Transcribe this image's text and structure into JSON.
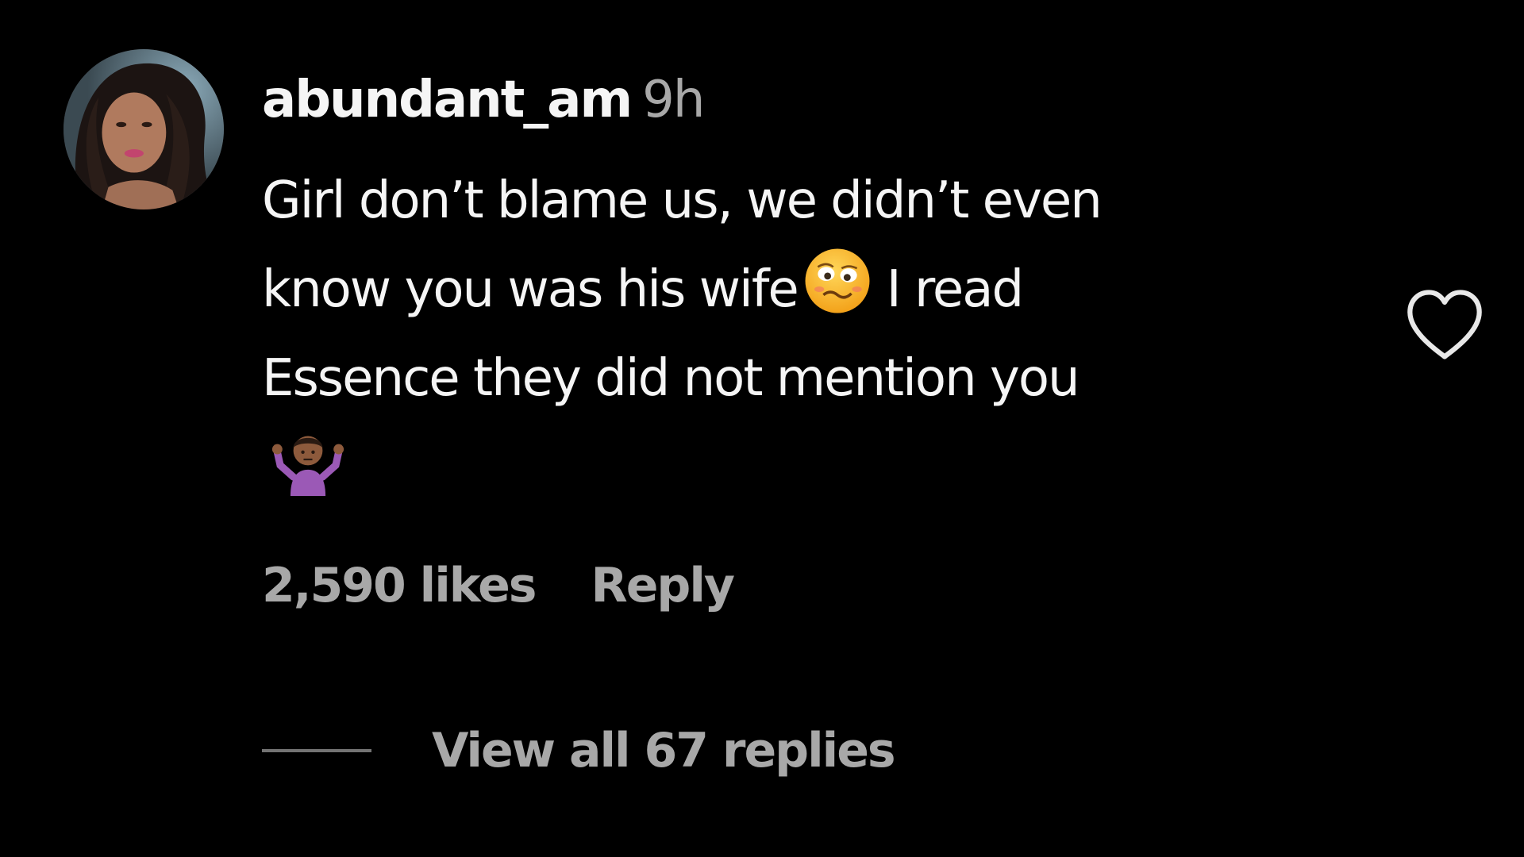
{
  "comment": {
    "username": "abundant_am",
    "timestamp": "9h",
    "text_lines": [
      "Girl don’t blame us, we didn’t even",
      "know you was his wife",
      "I read",
      "Essence they did not mention you"
    ],
    "emojis": [
      "woozy-face-emoji",
      "person-shrugging-emoji"
    ],
    "likes": "2,590 likes",
    "reply_label": "Reply",
    "view_replies_label": "View all 67 replies",
    "like_icon": "heart-outline-icon"
  },
  "colors": {
    "background": "#000000",
    "primary_text": "#f5f5f5",
    "secondary_text": "#a8a8a8",
    "rule": "#737373"
  }
}
